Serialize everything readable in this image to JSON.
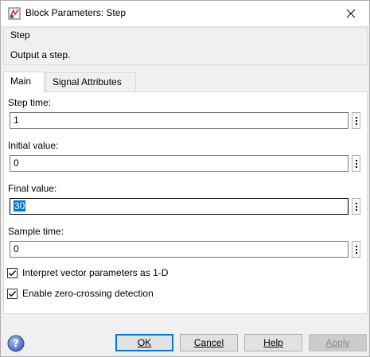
{
  "window": {
    "title": "Block Parameters: Step"
  },
  "description": {
    "block_name": "Step",
    "text": "Output a step."
  },
  "tabs": [
    {
      "label": "Main",
      "active": true
    },
    {
      "label": "Signal Attributes",
      "active": false
    }
  ],
  "params": [
    {
      "label": "Step time:",
      "value": "1"
    },
    {
      "label": "Initial value:",
      "value": "0"
    },
    {
      "label": "Final value:",
      "value": "30"
    },
    {
      "label": "Sample time:",
      "value": "0"
    }
  ],
  "checkboxes": [
    {
      "label": "Interpret vector parameters as 1-D",
      "checked": true
    },
    {
      "label": "Enable zero-crossing detection",
      "checked": true
    }
  ],
  "buttons": {
    "ok": "OK",
    "cancel": "Cancel",
    "help": "Help",
    "apply": "Apply"
  },
  "icons": {
    "app": "simulink-block-icon",
    "close": "close-icon",
    "help": "help-icon",
    "more": "vertical-ellipsis-icon"
  },
  "colors": {
    "accent": "#0078d7",
    "selection": "#0078d7",
    "disabled_text": "#8a8a8a"
  }
}
